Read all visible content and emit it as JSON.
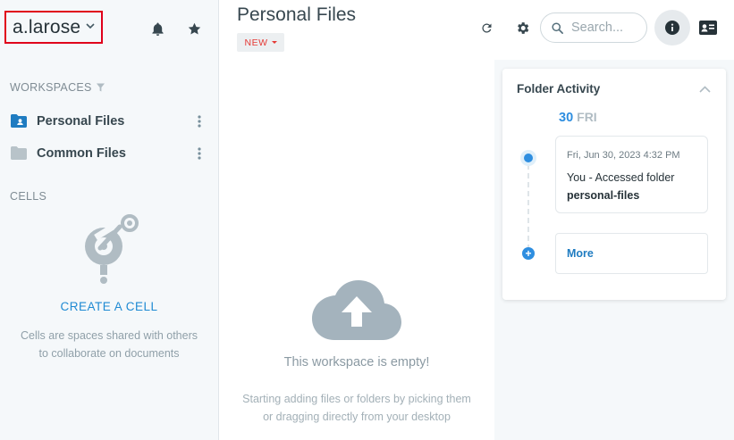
{
  "user": {
    "name": "a.larose"
  },
  "sidebar": {
    "workspaces_title": "WORKSPACES",
    "workspaces": [
      {
        "label": "Personal Files",
        "icon": "folder-user-icon"
      },
      {
        "label": "Common Files",
        "icon": "folder-icon"
      }
    ],
    "cells_title": "CELLS",
    "create_cell_label": "CREATE A CELL",
    "cells_help_line1": "Cells are spaces shared with others",
    "cells_help_line2": "to collaborate on documents"
  },
  "header": {
    "title": "Personal Files",
    "new_label": "NEW",
    "search_placeholder": "Search..."
  },
  "main": {
    "empty_title": "This workspace is empty!",
    "empty_help_line1": "Starting adding files or folders by picking them",
    "empty_help_line2": "or dragging directly from your desktop"
  },
  "activity": {
    "title": "Folder Activity",
    "date_num": "30",
    "date_day": "FRI",
    "event": {
      "time": "Fri, Jun 30, 2023 4:32 PM",
      "text_prefix": "You - Accessed folder",
      "text_target": "personal-files"
    },
    "more_label": "More"
  },
  "colors": {
    "accent": "#2e8ee0",
    "new_red": "#e53935",
    "highlight_border": "#e0001b",
    "sidebar_bg": "#f5f8fa"
  }
}
